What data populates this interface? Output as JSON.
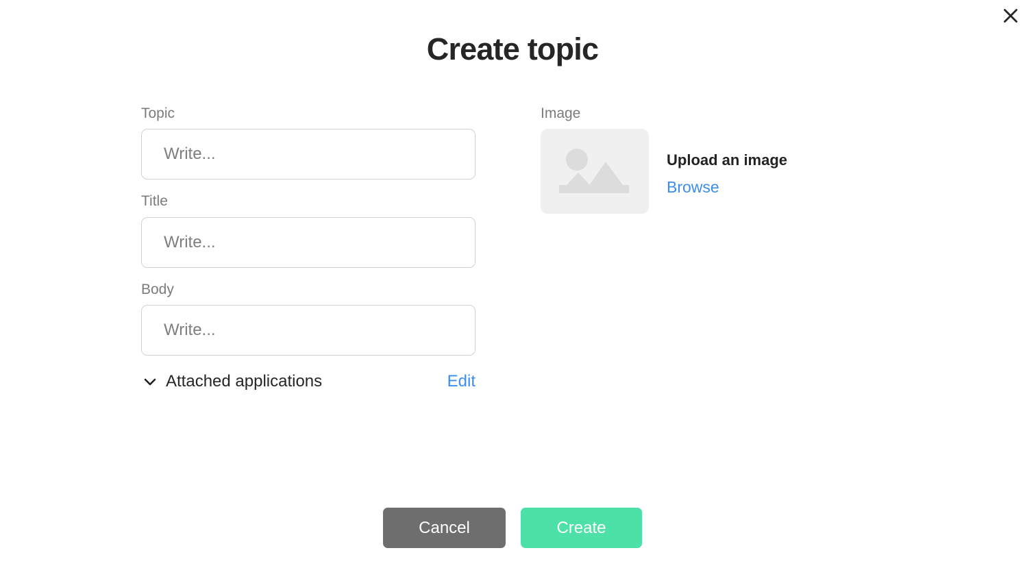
{
  "dialog": {
    "title": "Create topic",
    "close_icon": "close-icon"
  },
  "form": {
    "fields": [
      {
        "label": "Topic",
        "placeholder": "Write...",
        "value": ""
      },
      {
        "label": "Title",
        "placeholder": "Write...",
        "value": ""
      },
      {
        "label": "Body",
        "placeholder": "Write...",
        "value": ""
      }
    ],
    "attached": {
      "label": "Attached applications",
      "edit_label": "Edit",
      "chevron_icon": "chevron-down-icon",
      "expanded": false
    }
  },
  "image_section": {
    "label": "Image",
    "placeholder_icon": "image-placeholder-icon",
    "heading": "Upload an image",
    "browse_label": "Browse"
  },
  "footer": {
    "cancel_label": "Cancel",
    "create_label": "Create"
  },
  "colors": {
    "accent_green": "#4de0a7",
    "cancel_gray": "#6e6e6e",
    "link_blue": "#3b8ef0",
    "label_gray": "#7b7b7b",
    "border_gray": "#d2d2d2",
    "thumb_bg": "#f0f0f0",
    "thumb_icon": "#dcdcdc",
    "text_dark": "#262626",
    "page_bg": "#ffffff"
  }
}
